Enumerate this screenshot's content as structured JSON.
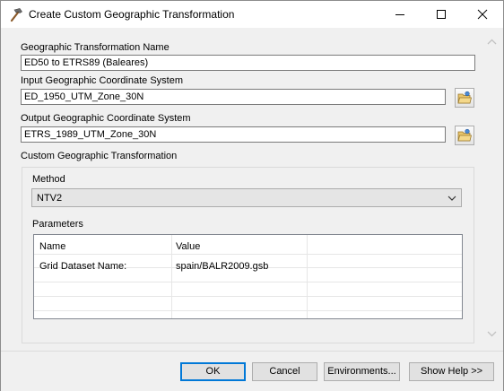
{
  "window": {
    "title": "Create Custom Geographic Transformation",
    "app_icon": "hammer-icon"
  },
  "fields": {
    "gt_name_label": "Geographic Transformation Name",
    "gt_name_value": "ED50 to ETRS89 (Baleares)",
    "input_gcs_label": "Input Geographic Coordinate System",
    "input_gcs_value": "ED_1950_UTM_Zone_30N",
    "output_gcs_label": "Output Geographic Coordinate System",
    "output_gcs_value": "ETRS_1989_UTM_Zone_30N"
  },
  "custom_transformation": {
    "group_label": "Custom Geographic Transformation",
    "method_label": "Method",
    "method_value": "NTV2",
    "parameters_label": "Parameters",
    "columns": [
      "Name",
      "Value"
    ],
    "rows": [
      {
        "name": "Grid Dataset Name:",
        "value": "spain/BALR2009.gsb"
      }
    ]
  },
  "buttons": {
    "ok": "OK",
    "cancel": "Cancel",
    "environments": "Environments...",
    "show_help": "Show Help >>"
  }
}
